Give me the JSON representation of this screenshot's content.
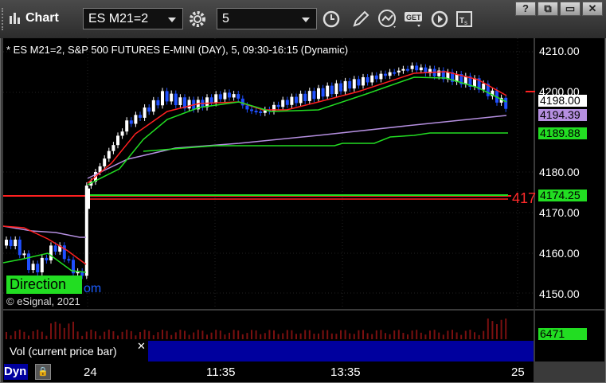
{
  "window": {
    "title": "Chart",
    "symbol": "ES M21=2",
    "interval": "5",
    "buttons": [
      "?",
      "⧉",
      "▭",
      "✕"
    ]
  },
  "chart": {
    "legend": "* ES M21=2, S&P 500 FUTURES E-MINI (DAY), 5, 09:30-16:15 (Dynamic)",
    "copyright": "© eSignal, 2021",
    "direction_label": "Direction",
    "direction_tail": "om",
    "ref_label": "417",
    "price_ticks": [
      "4210.00",
      "4200.00",
      "4180.00",
      "4170.00",
      "4160.00",
      "4150.00"
    ],
    "price_labels": [
      {
        "text": "4198.00",
        "bg": "#ffffff",
        "fg": "#000000",
        "value": 4198.0
      },
      {
        "text": "4194.39",
        "bg": "#b58fe0",
        "fg": "#000000",
        "value": 4194.39
      },
      {
        "text": "4189.88",
        "bg": "#22dd22",
        "fg": "#000000",
        "value": 4189.88
      },
      {
        "text": "4174.25",
        "bg": "#22dd22",
        "fg": "#000000",
        "value": 4174.25
      }
    ],
    "volume_label": "6471",
    "volume_study": "Vol (current price bar)",
    "time_ticks": [
      "24",
      "11:35",
      "13:35",
      "25"
    ],
    "dyn_label": "Dyn",
    "colors": {
      "background": "#000000",
      "up_candle": "#ffffff",
      "down_candle": "#1f4fff",
      "fast_ma": "#ff2020",
      "slow_ma": "#22dd22",
      "vwap": "#b58fe0",
      "level_green": "#22dd22",
      "level_red": "#ff2020",
      "volume": "#7a1010"
    }
  }
}
